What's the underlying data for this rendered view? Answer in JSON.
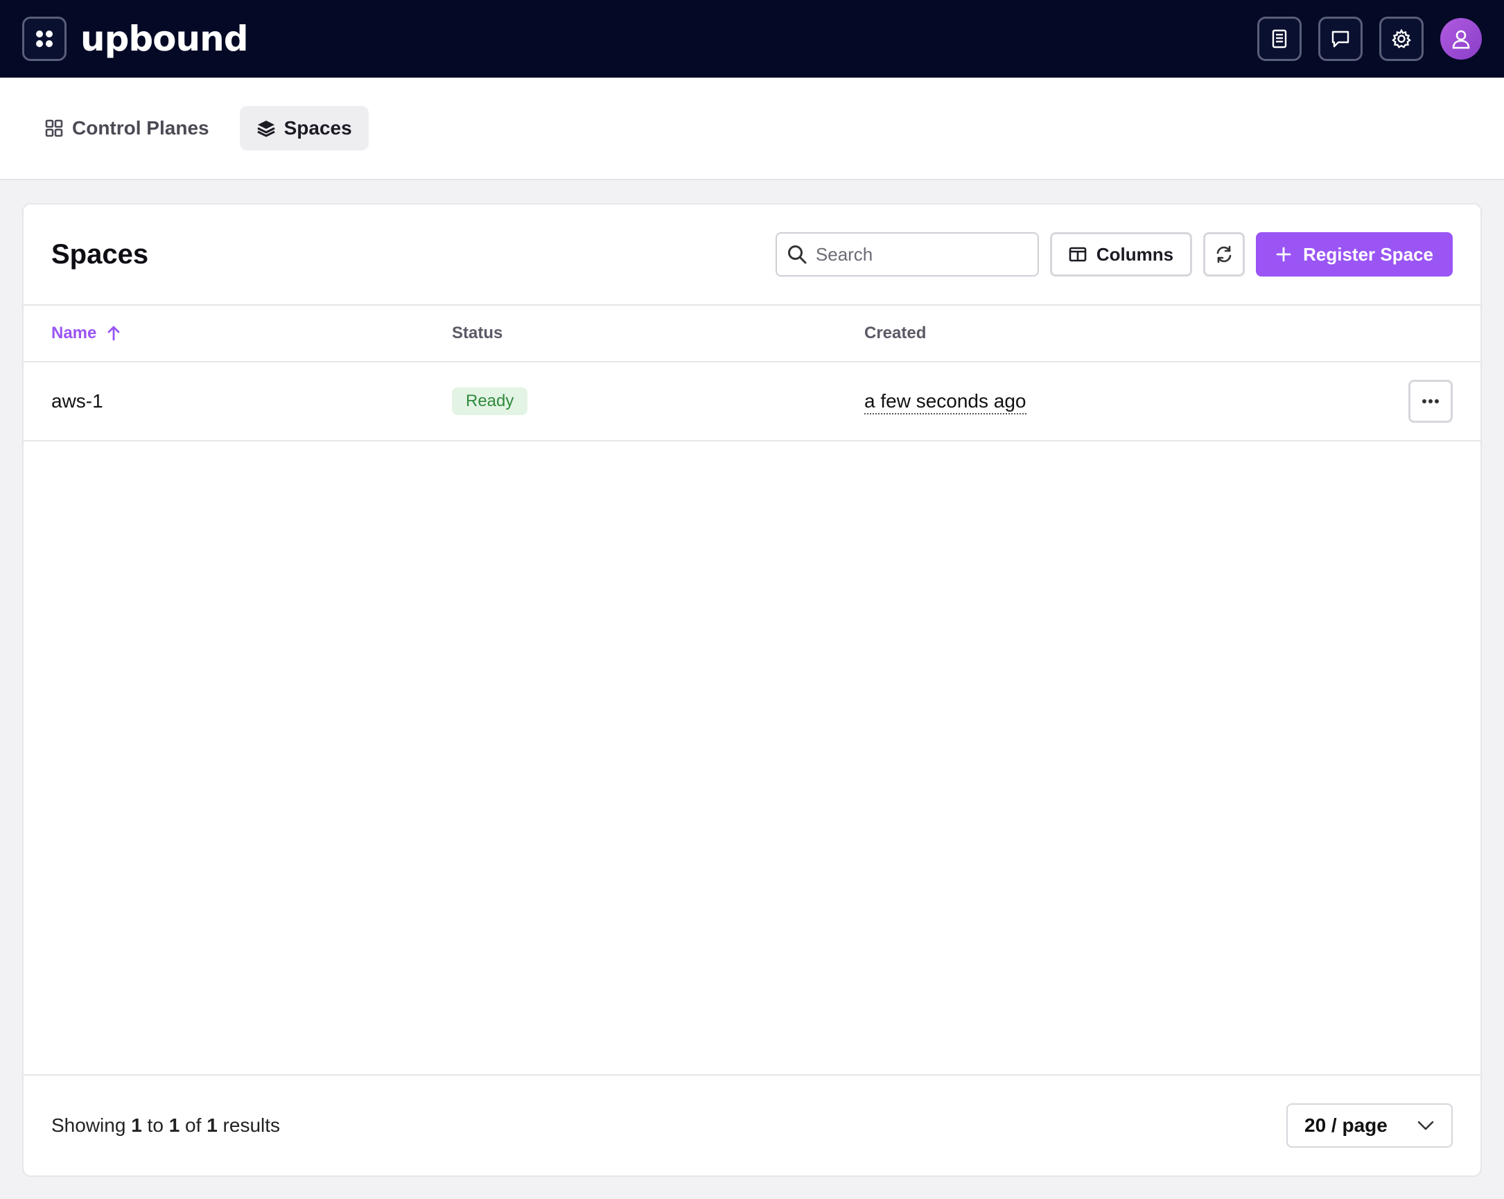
{
  "header": {
    "logo_text": "upbound",
    "icons": [
      "apps-grid-icon",
      "docs-icon",
      "chat-icon",
      "settings-gear-icon",
      "user-avatar-icon"
    ]
  },
  "nav": {
    "tabs": [
      {
        "label": "Control Planes",
        "icon": "grid-icon",
        "active": false
      },
      {
        "label": "Spaces",
        "icon": "layers-icon",
        "active": true
      }
    ]
  },
  "page": {
    "title": "Spaces",
    "search_placeholder": "Search",
    "columns_label": "Columns",
    "register_label": "Register Space"
  },
  "table": {
    "columns": {
      "name": "Name",
      "status": "Status",
      "created": "Created"
    },
    "rows": [
      {
        "name": "aws-1",
        "status": "Ready",
        "created": "a few seconds ago"
      }
    ]
  },
  "footer": {
    "showing": "Showing",
    "from": "1",
    "to_word": "to",
    "to": "1",
    "of_word": "of",
    "total": "1",
    "results_word": "results",
    "page_size": "20 / page"
  },
  "colors": {
    "topbar": "#040926",
    "accent": "#9a55f4",
    "ready_bg": "#e3f4e5",
    "ready_text": "#2f8a3b"
  }
}
